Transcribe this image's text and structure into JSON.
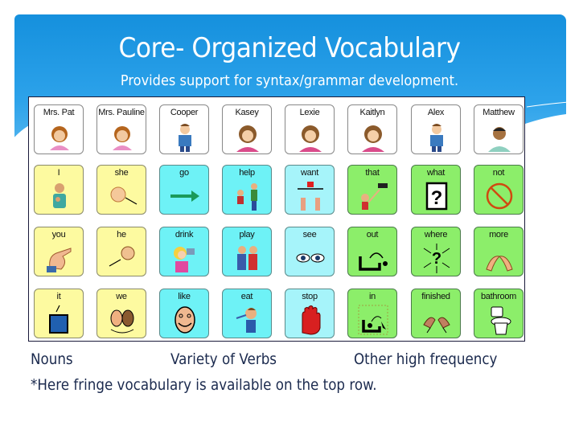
{
  "slide": {
    "title": "Core- Organized Vocabulary",
    "subtitle": "Provides support for syntax/grammar development.",
    "colors": {
      "banner_top": "#1590dd",
      "banner_bottom": "#9fd8f6",
      "text_dark": "#1b2a4e",
      "cell_white": "#ffffff",
      "cell_yellow": "#fdfaa0",
      "cell_cyan": "#6ef2f6",
      "cell_green": "#8cee6a"
    }
  },
  "board": {
    "rows": [
      [
        {
          "label": "Mrs. Pat",
          "icon": "woman-face-icon",
          "color": "white"
        },
        {
          "label": "Mrs. Pauline",
          "icon": "woman-face-icon",
          "color": "white"
        },
        {
          "label": "Cooper",
          "icon": "boy-person-icon",
          "color": "white"
        },
        {
          "label": "Kasey",
          "icon": "girl-face-icon",
          "color": "white"
        },
        {
          "label": "Lexie",
          "icon": "girl-face-icon",
          "color": "white"
        },
        {
          "label": "Kaitlyn",
          "icon": "girl-face-icon",
          "color": "white"
        },
        {
          "label": "Alex",
          "icon": "boy-person-icon",
          "color": "white"
        },
        {
          "label": "Matthew",
          "icon": "man-face-icon",
          "color": "white"
        }
      ],
      [
        {
          "label": "I",
          "icon": "self-point-icon",
          "color": "yellow"
        },
        {
          "label": "she",
          "icon": "she-point-icon",
          "color": "yellow"
        },
        {
          "label": "go",
          "icon": "arrow-right-icon",
          "color": "cyan"
        },
        {
          "label": "help",
          "icon": "help-people-icon",
          "color": "cyan"
        },
        {
          "label": "want",
          "icon": "want-hands-icon",
          "color": "ltcyan"
        },
        {
          "label": "that",
          "icon": "point-that-icon",
          "color": "green"
        },
        {
          "label": "what",
          "icon": "question-box-icon",
          "color": "green"
        },
        {
          "label": "not",
          "icon": "no-sign-icon",
          "color": "green"
        }
      ],
      [
        {
          "label": "you",
          "icon": "point-finger-icon",
          "color": "yellow"
        },
        {
          "label": "he",
          "icon": "he-point-icon",
          "color": "yellow"
        },
        {
          "label": "drink",
          "icon": "drink-icon",
          "color": "cyan"
        },
        {
          "label": "play",
          "icon": "play-people-icon",
          "color": "cyan"
        },
        {
          "label": "see",
          "icon": "eyes-icon",
          "color": "ltcyan"
        },
        {
          "label": "out",
          "icon": "out-arrow-icon",
          "color": "green"
        },
        {
          "label": "where",
          "icon": "where-arrows-icon",
          "color": "green"
        },
        {
          "label": "more",
          "icon": "more-hands-icon",
          "color": "green"
        }
      ],
      [
        {
          "label": "it",
          "icon": "blue-square-icon",
          "color": "yellow"
        },
        {
          "label": "we",
          "icon": "two-faces-icon",
          "color": "yellow"
        },
        {
          "label": "like",
          "icon": "smile-face-icon",
          "color": "cyan"
        },
        {
          "label": "eat",
          "icon": "eat-icon",
          "color": "cyan"
        },
        {
          "label": "stop",
          "icon": "stop-hand-icon",
          "color": "ltcyan"
        },
        {
          "label": "in",
          "icon": "in-arrow-icon",
          "color": "green"
        },
        {
          "label": "finished",
          "icon": "finished-hands-icon",
          "color": "green"
        },
        {
          "label": "bathroom",
          "icon": "toilet-icon",
          "color": "green"
        }
      ]
    ]
  },
  "captions": {
    "nouns": "Nouns",
    "verbs": "Variety of Verbs",
    "other": "Other high frequency",
    "note": "*Here fringe vocabulary is available on the top row."
  }
}
